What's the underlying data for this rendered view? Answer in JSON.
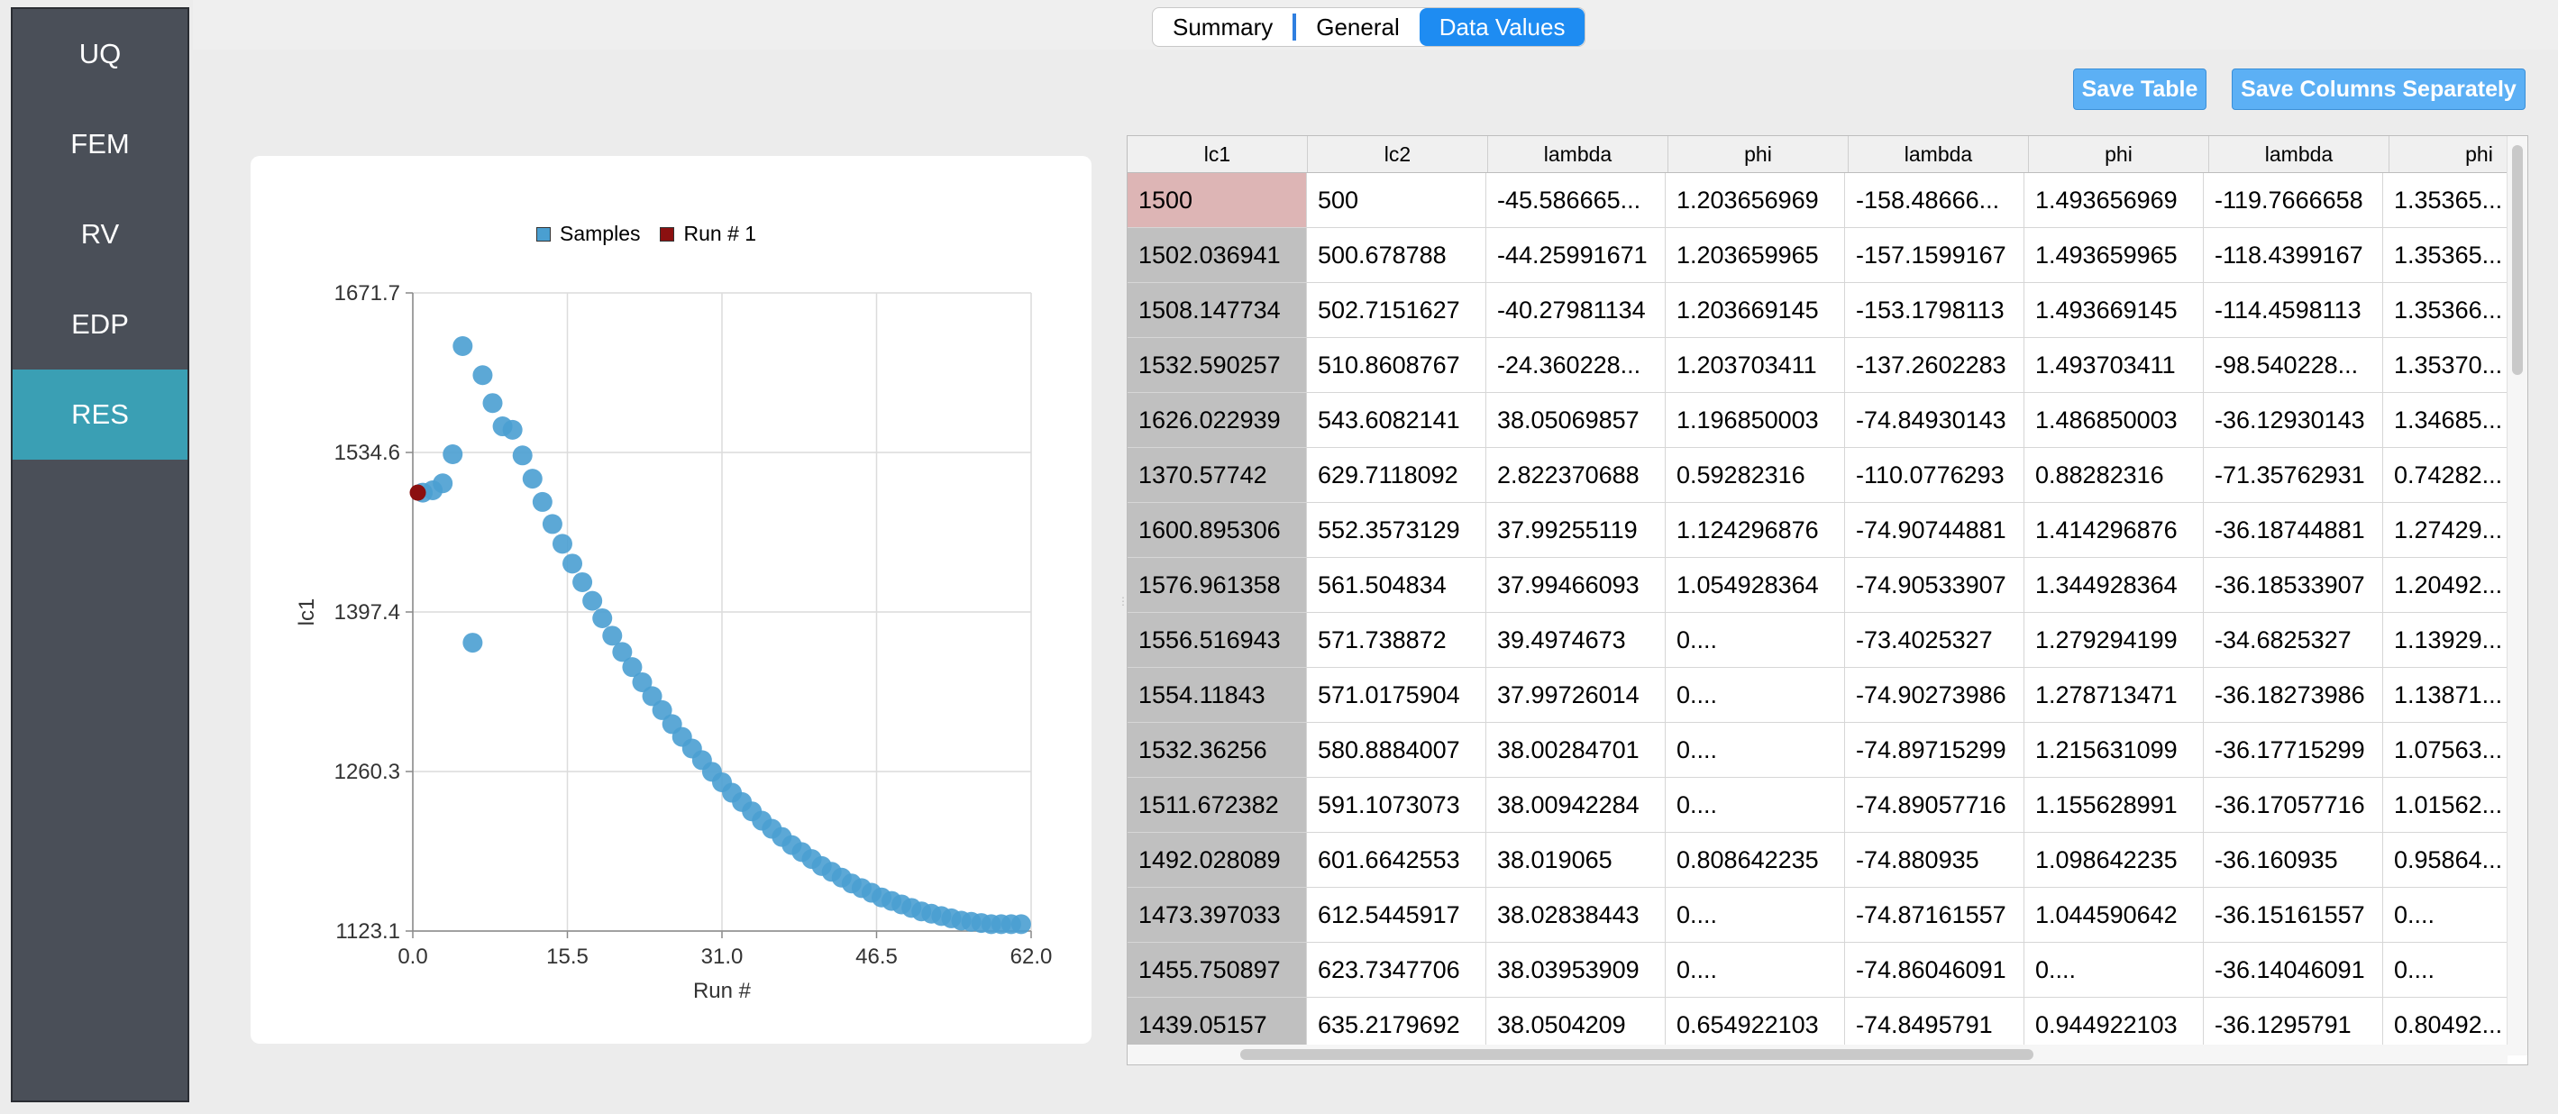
{
  "sidebar": {
    "items": [
      {
        "label": "UQ",
        "active": false
      },
      {
        "label": "FEM",
        "active": false
      },
      {
        "label": "RV",
        "active": false
      },
      {
        "label": "EDP",
        "active": false
      },
      {
        "label": "RES",
        "active": true
      }
    ]
  },
  "tabs": [
    {
      "label": "Summary",
      "active": false
    },
    {
      "label": "General",
      "active": false
    },
    {
      "label": "Data Values",
      "active": true
    }
  ],
  "buttons": {
    "save_table": "Save Table",
    "save_columns": "Save Columns Separately"
  },
  "colors": {
    "samples": "#4a9fd1",
    "run": "#8b1010",
    "accent": "#1e8cf2",
    "sidebar_active": "#3a9fb4"
  },
  "chart_data": {
    "type": "scatter",
    "xlabel": "Run #",
    "ylabel": "lc1",
    "xlim": [
      0.0,
      62.0
    ],
    "ylim": [
      1123.1,
      1671.7
    ],
    "xticks": [
      "0.0",
      "15.5",
      "31.0",
      "46.5",
      "62.0"
    ],
    "yticks": [
      "1123.1",
      "1260.3",
      "1397.4",
      "1534.6",
      "1671.7"
    ],
    "grid": true,
    "legend_position": "top",
    "series": [
      {
        "name": "Samples",
        "color": "#4a9fd1",
        "points": [
          [
            1,
            1500
          ],
          [
            2,
            1502
          ],
          [
            3,
            1508
          ],
          [
            4,
            1533
          ],
          [
            5,
            1626
          ],
          [
            6,
            1371
          ],
          [
            7,
            1601
          ],
          [
            8,
            1577
          ],
          [
            9,
            1557
          ],
          [
            10,
            1554
          ],
          [
            11,
            1532
          ],
          [
            12,
            1512
          ],
          [
            13,
            1492
          ],
          [
            14,
            1473
          ],
          [
            15,
            1456
          ],
          [
            16,
            1439
          ],
          [
            17,
            1423
          ],
          [
            18,
            1407
          ],
          [
            19,
            1392
          ],
          [
            20,
            1377
          ],
          [
            21,
            1363
          ],
          [
            22,
            1350
          ],
          [
            23,
            1337
          ],
          [
            24,
            1325
          ],
          [
            25,
            1313
          ],
          [
            26,
            1301
          ],
          [
            27,
            1290
          ],
          [
            28,
            1280
          ],
          [
            29,
            1270
          ],
          [
            30,
            1260
          ],
          [
            31,
            1251
          ],
          [
            32,
            1242
          ],
          [
            33,
            1234
          ],
          [
            34,
            1226
          ],
          [
            35,
            1218
          ],
          [
            36,
            1211
          ],
          [
            37,
            1204
          ],
          [
            38,
            1197
          ],
          [
            39,
            1191
          ],
          [
            40,
            1185
          ],
          [
            41,
            1179
          ],
          [
            42,
            1174
          ],
          [
            43,
            1169
          ],
          [
            44,
            1164
          ],
          [
            45,
            1160
          ],
          [
            46,
            1156
          ],
          [
            47,
            1152
          ],
          [
            48,
            1149
          ],
          [
            49,
            1146
          ],
          [
            50,
            1143
          ],
          [
            51,
            1140
          ],
          [
            52,
            1138
          ],
          [
            53,
            1136
          ],
          [
            54,
            1134
          ],
          [
            55,
            1132
          ],
          [
            56,
            1131
          ],
          [
            57,
            1130
          ],
          [
            58,
            1129
          ],
          [
            59,
            1129
          ],
          [
            60,
            1129
          ],
          [
            61,
            1129
          ]
        ]
      },
      {
        "name": "Run # 1",
        "color": "#8b1010",
        "points": [
          [
            0.5,
            1500
          ]
        ]
      }
    ]
  },
  "table": {
    "columns": [
      "lc1",
      "lc2",
      "lambda",
      "phi",
      "lambda",
      "phi",
      "lambda",
      "phi"
    ],
    "selected_row": 0,
    "rows": [
      [
        "1500",
        "500",
        "-45.586665...",
        "1.203656969",
        "-158.48666...",
        "1.493656969",
        "-119.7666658",
        "1.35365..."
      ],
      [
        "1502.036941",
        "500.678788",
        "-44.25991671",
        "1.203659965",
        "-157.1599167",
        "1.493659965",
        "-118.4399167",
        "1.35365..."
      ],
      [
        "1508.147734",
        "502.7151627",
        "-40.27981134",
        "1.203669145",
        "-153.1798113",
        "1.493669145",
        "-114.4598113",
        "1.35366..."
      ],
      [
        "1532.590257",
        "510.8608767",
        "-24.360228...",
        "1.203703411",
        "-137.2602283",
        "1.493703411",
        "-98.540228...",
        "1.35370..."
      ],
      [
        "1626.022939",
        "543.6082141",
        "38.05069857",
        "1.196850003",
        "-74.84930143",
        "1.486850003",
        "-36.12930143",
        "1.34685..."
      ],
      [
        "1370.57742",
        "629.7118092",
        "2.822370688",
        "0.59282316",
        "-110.0776293",
        "0.88282316",
        "-71.35762931",
        "0.74282..."
      ],
      [
        "1600.895306",
        "552.3573129",
        "37.99255119",
        "1.124296876",
        "-74.90744881",
        "1.414296876",
        "-36.18744881",
        "1.27429..."
      ],
      [
        "1576.961358",
        "561.504834",
        "37.99466093",
        "1.054928364",
        "-74.90533907",
        "1.344928364",
        "-36.18533907",
        "1.20492..."
      ],
      [
        "1556.516943",
        "571.738872",
        "39.4974673",
        "0....",
        "-73.4025327",
        "1.279294199",
        "-34.6825327",
        "1.13929..."
      ],
      [
        "1554.11843",
        "571.0175904",
        "37.99726014",
        "0....",
        "-74.90273986",
        "1.278713471",
        "-36.18273986",
        "1.13871..."
      ],
      [
        "1532.36256",
        "580.8884007",
        "38.00284701",
        "0....",
        "-74.89715299",
        "1.215631099",
        "-36.17715299",
        "1.07563..."
      ],
      [
        "1511.672382",
        "591.1073073",
        "38.00942284",
        "0....",
        "-74.89057716",
        "1.155628991",
        "-36.17057716",
        "1.01562..."
      ],
      [
        "1492.028089",
        "601.6642553",
        "38.019065",
        "0.808642235",
        "-74.880935",
        "1.098642235",
        "-36.160935",
        "0.95864..."
      ],
      [
        "1473.397033",
        "612.5445917",
        "38.02838443",
        "0....",
        "-74.87161557",
        "1.044590642",
        "-36.15161557",
        "0...."
      ],
      [
        "1455.750897",
        "623.7347706",
        "38.03953909",
        "0....",
        "-74.86046091",
        "0....",
        "-36.14046091",
        "0...."
      ],
      [
        "1439.05157",
        "635.2179692",
        "38.0504209",
        "0.654922103",
        "-74.8495791",
        "0.944922103",
        "-36.1295791",
        "0.80492..."
      ]
    ]
  }
}
